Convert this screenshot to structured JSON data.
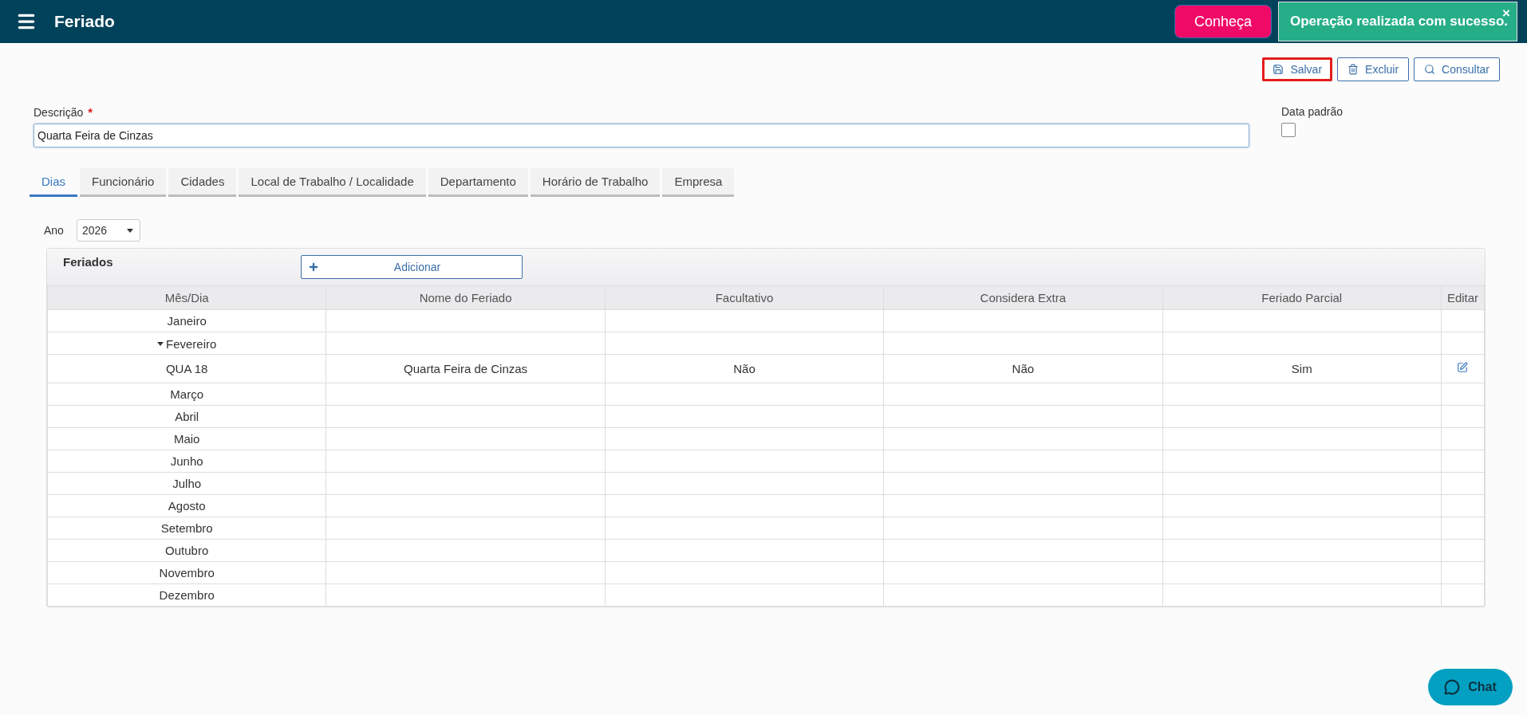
{
  "header": {
    "title": "Feriado",
    "promo_button": "Conheça",
    "toast": {
      "message": "Operação realizada com sucesso.",
      "close": "×"
    }
  },
  "actions": [
    {
      "label": "Salvar",
      "kind": "save",
      "highlighted": true
    },
    {
      "label": "Excluir",
      "kind": "delete",
      "highlighted": false
    },
    {
      "label": "Consultar",
      "kind": "search",
      "highlighted": false
    }
  ],
  "form": {
    "description": {
      "label": "Descrição",
      "required_mark": "*",
      "value": "Quarta Feira de Cinzas"
    },
    "default_date": {
      "label": "Data padrão",
      "checked": false
    }
  },
  "tabs": [
    {
      "label": "Dias",
      "selected": true
    },
    {
      "label": "Funcionário",
      "selected": false
    },
    {
      "label": "Cidades",
      "selected": false
    },
    {
      "label": "Local de Trabalho / Localidade",
      "selected": false
    },
    {
      "label": "Departamento",
      "selected": false
    },
    {
      "label": "Horário de Trabalho",
      "selected": false
    },
    {
      "label": "Empresa",
      "selected": false
    }
  ],
  "year": {
    "label": "Ano",
    "value": "2026"
  },
  "holidays": {
    "title": "Feriados",
    "add_button": "Adicionar",
    "columns": [
      "Mês/Dia",
      "Nome do Feriado",
      "Facultativo",
      "Considera Extra",
      "Feriado Parcial",
      "Editar"
    ],
    "groups": [
      {
        "month": "Janeiro",
        "expanded": false
      },
      {
        "month": "Fevereiro",
        "expanded": true,
        "rows": [
          {
            "day": "QUA 18",
            "name": "Quarta Feira de Cinzas",
            "optional": "Não",
            "extra": "Não",
            "partial": "Sim"
          }
        ]
      },
      {
        "month": "Março",
        "expanded": false
      },
      {
        "month": "Abril",
        "expanded": false
      },
      {
        "month": "Maio",
        "expanded": false
      },
      {
        "month": "Junho",
        "expanded": false
      },
      {
        "month": "Julho",
        "expanded": false
      },
      {
        "month": "Agosto",
        "expanded": false
      },
      {
        "month": "Setembro",
        "expanded": false
      },
      {
        "month": "Outubro",
        "expanded": false
      },
      {
        "month": "Novembro",
        "expanded": false
      },
      {
        "month": "Dezembro",
        "expanded": false
      }
    ]
  },
  "chat_button": "Chat"
}
